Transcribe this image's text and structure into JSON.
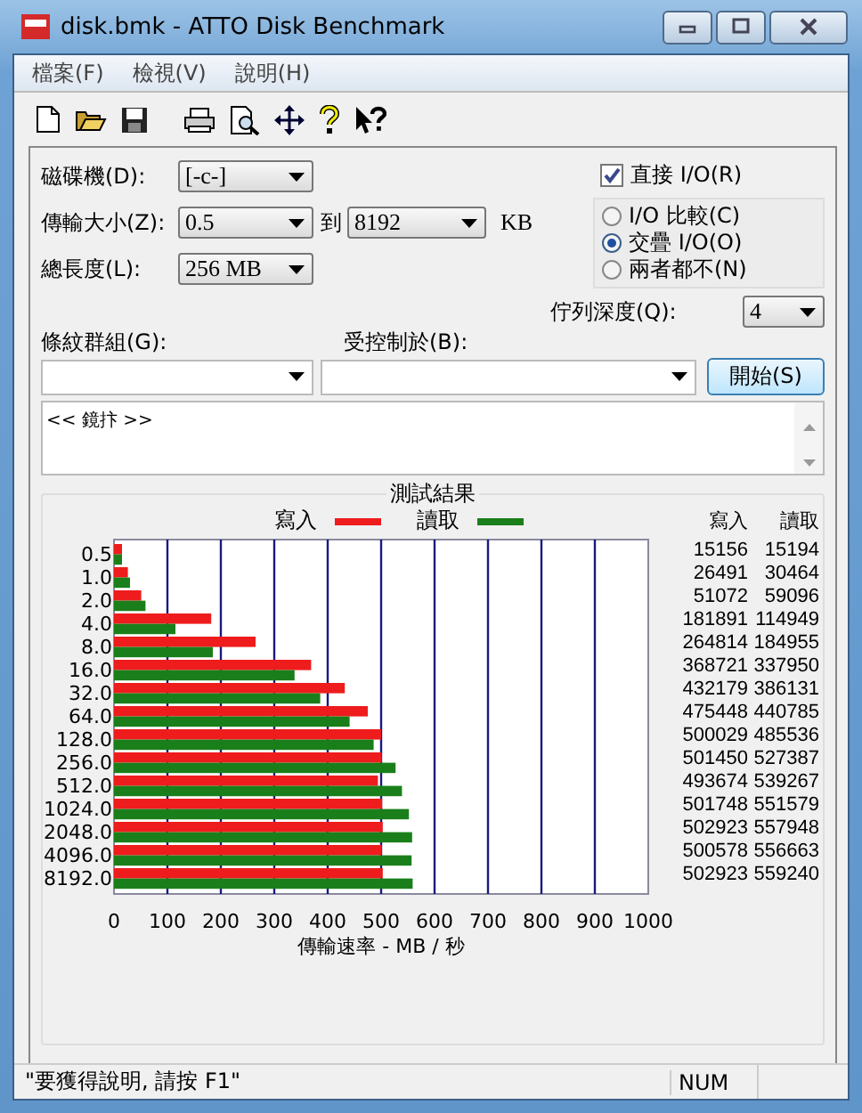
{
  "window": {
    "title": "disk.bmk - ATTO Disk Benchmark"
  },
  "menu": [
    {
      "label": "檔案(F)"
    },
    {
      "label": "檢視(V)"
    },
    {
      "label": "說明(H)"
    }
  ],
  "form": {
    "drive": {
      "label": "磁碟機(D):",
      "value": "[-c-]"
    },
    "transfer_size": {
      "label": "傳輸大小(Z):",
      "from": "0.5",
      "to_label": "到",
      "to": "8192",
      "unit": "KB"
    },
    "total_length": {
      "label": "總長度(L):",
      "value": "256 MB"
    },
    "direct_io": {
      "label": "直接 I/O(R)",
      "checked": true
    },
    "io_options": [
      {
        "label": "I/O 比較(C)",
        "selected": false
      },
      {
        "label": "交疊 I/O(O)",
        "selected": true
      },
      {
        "label": "兩者都不(N)",
        "selected": false
      }
    ],
    "queue_depth": {
      "label": "佇列深度(Q):",
      "value": "4"
    },
    "stripe_group": {
      "label": "條紋群組(G):"
    },
    "controlled_by": {
      "label": "受控制於(B):"
    },
    "start_button": "開始(S)",
    "description": "<< 鏡抃 >>"
  },
  "results": {
    "title": "測試結果",
    "chart_data": {
      "type": "bar",
      "orientation": "horizontal",
      "xlabel": "傳輸速率 - MB / 秒",
      "categories": [
        "0.5",
        "1.0",
        "2.0",
        "4.0",
        "8.0",
        "16.0",
        "32.0",
        "64.0",
        "128.0",
        "256.0",
        "512.0",
        "1024.0",
        "2048.0",
        "4096.0",
        "8192.0"
      ],
      "series": [
        {
          "name": "寫入",
          "color": "#ee1c1c",
          "values": [
            15,
            26,
            51,
            182,
            265,
            369,
            432,
            475,
            500,
            501,
            494,
            502,
            503,
            501,
            503
          ]
        },
        {
          "name": "讀取",
          "color": "#1a7f1a",
          "values": [
            15,
            30,
            59,
            115,
            185,
            338,
            386,
            441,
            486,
            527,
            539,
            552,
            558,
            557,
            559
          ]
        }
      ],
      "grid": true,
      "xlim": [
        0,
        1000
      ],
      "xticks": [
        0,
        100,
        200,
        300,
        400,
        500,
        600,
        700,
        800,
        900,
        1000
      ]
    },
    "table": {
      "columns": [
        "寫入",
        "讀取"
      ],
      "rows": [
        [
          "15156",
          "15194"
        ],
        [
          "26491",
          "30464"
        ],
        [
          "51072",
          "59096"
        ],
        [
          "181891",
          "114949"
        ],
        [
          "264814",
          "184955"
        ],
        [
          "368721",
          "337950"
        ],
        [
          "432179",
          "386131"
        ],
        [
          "475448",
          "440785"
        ],
        [
          "500029",
          "485536"
        ],
        [
          "501450",
          "527387"
        ],
        [
          "493674",
          "539267"
        ],
        [
          "501748",
          "551579"
        ],
        [
          "502923",
          "557948"
        ],
        [
          "500578",
          "556663"
        ],
        [
          "502923",
          "559240"
        ]
      ]
    }
  },
  "status_bar": {
    "message": "\"要獲得說明, 請按 F1\"",
    "indicator": "NUM"
  }
}
